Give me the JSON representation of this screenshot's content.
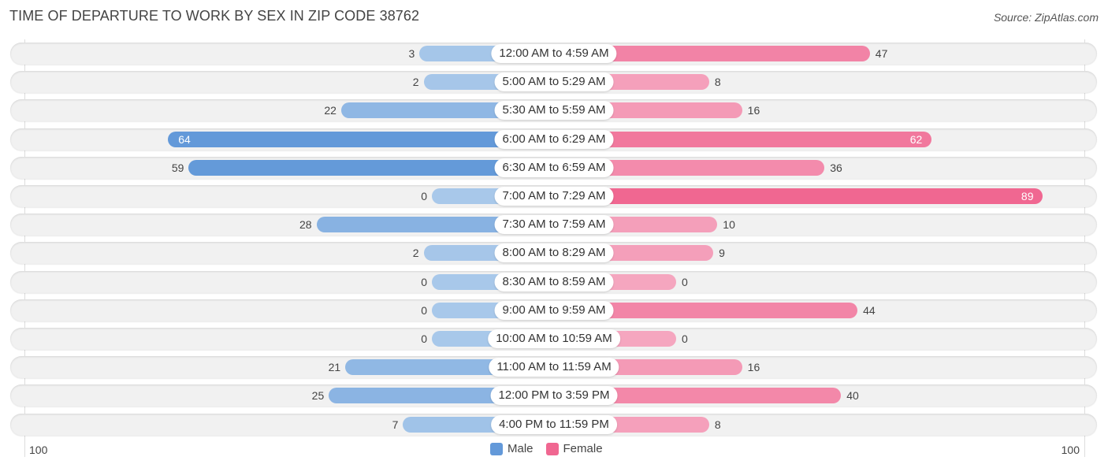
{
  "header": {
    "title": "TIME OF DEPARTURE TO WORK BY SEX IN ZIP CODE 38762",
    "source": "Source: ZipAtlas.com"
  },
  "colors": {
    "male_light": "#a8c8ea",
    "male_dark": "#6399d9",
    "female_light": "#f5a6bf",
    "female_dark": "#f06791"
  },
  "chart_data": {
    "type": "bar",
    "orientation": "horizontal-diverging",
    "title": "TIME OF DEPARTURE TO WORK BY SEX IN ZIP CODE 38762",
    "categories": [
      "12:00 AM to 4:59 AM",
      "5:00 AM to 5:29 AM",
      "5:30 AM to 5:59 AM",
      "6:00 AM to 6:29 AM",
      "6:30 AM to 6:59 AM",
      "7:00 AM to 7:29 AM",
      "7:30 AM to 7:59 AM",
      "8:00 AM to 8:29 AM",
      "8:30 AM to 8:59 AM",
      "9:00 AM to 9:59 AM",
      "10:00 AM to 10:59 AM",
      "11:00 AM to 11:59 AM",
      "12:00 PM to 3:59 PM",
      "4:00 PM to 11:59 PM"
    ],
    "series": [
      {
        "name": "Male",
        "values": [
          3,
          2,
          22,
          64,
          59,
          0,
          28,
          2,
          0,
          0,
          0,
          21,
          25,
          7
        ]
      },
      {
        "name": "Female",
        "values": [
          47,
          8,
          16,
          62,
          36,
          89,
          10,
          9,
          0,
          44,
          0,
          16,
          40,
          8
        ]
      }
    ],
    "axis": {
      "left_label": "100",
      "right_label": "100",
      "range": [
        0,
        100
      ]
    },
    "legend": {
      "position": "bottom-center",
      "items": [
        "Male",
        "Female"
      ]
    }
  }
}
